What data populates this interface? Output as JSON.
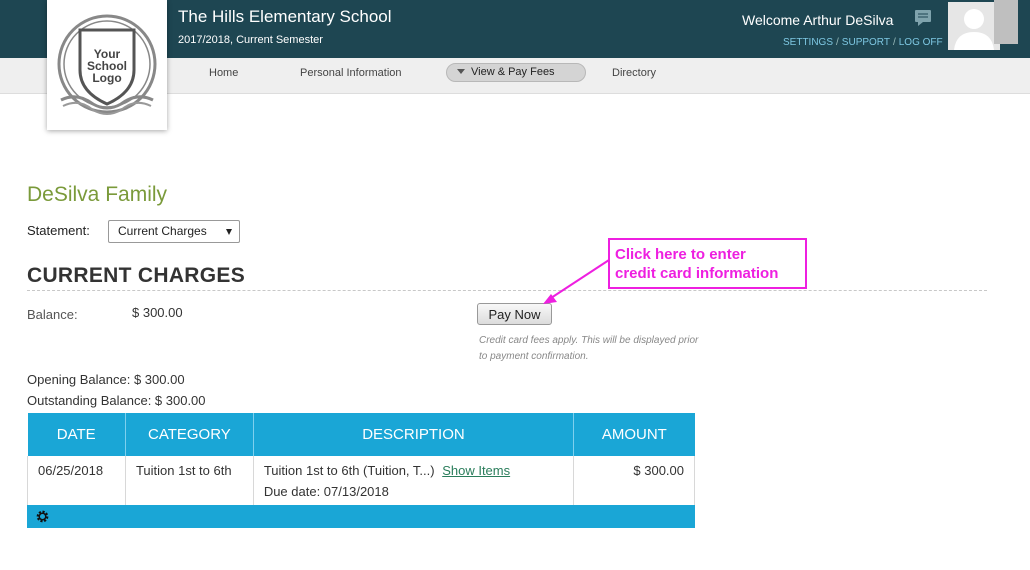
{
  "header": {
    "school_name": "The Hills Elementary School",
    "term": "2017/2018, Current Semester",
    "welcome": "Welcome Arthur DeSilva",
    "links": [
      "SETTINGS",
      "SUPPORT",
      "LOG OFF"
    ],
    "logo_lines": [
      "Your",
      "School",
      "Logo"
    ]
  },
  "nav": {
    "items": [
      "Home",
      "Personal Information",
      "View & Pay Fees",
      "Directory"
    ],
    "active_index": 2
  },
  "main": {
    "family_name": "DeSilva Family",
    "statement_label": "Statement:",
    "statement_selected": "Current Charges",
    "section_title": "CURRENT CHARGES",
    "balance_label": "Balance:",
    "balance_value": "$ 300.00",
    "pay_button": "Pay Now",
    "fee_note": "Credit card fees apply. This will be displayed prior to payment confirmation.",
    "callout_lines": [
      "Click here to enter",
      "credit card information"
    ],
    "opening_balance": "Opening Balance: $ 300.00",
    "outstanding_balance": "Outstanding Balance: $ 300.00"
  },
  "table": {
    "headers": [
      "DATE",
      "CATEGORY",
      "DESCRIPTION",
      "AMOUNT"
    ],
    "rows": [
      {
        "date": "06/25/2018",
        "category": "Tuition 1st to 6th",
        "description": "Tuition 1st to 6th  (Tuition, T...)",
        "link": "Show Items",
        "due": "Due date: 07/13/2018",
        "amount": "$ 300.00"
      }
    ]
  },
  "colors": {
    "header_bg": "#1e4652",
    "accent_blue": "#1aa6d6",
    "family_green": "#7a9a3a",
    "callout_magenta": "#ee1fe0"
  },
  "icons": [
    "message-icon",
    "avatar-icon",
    "dropdown-caret-icon",
    "gear-icon",
    "arrow-icon"
  ]
}
